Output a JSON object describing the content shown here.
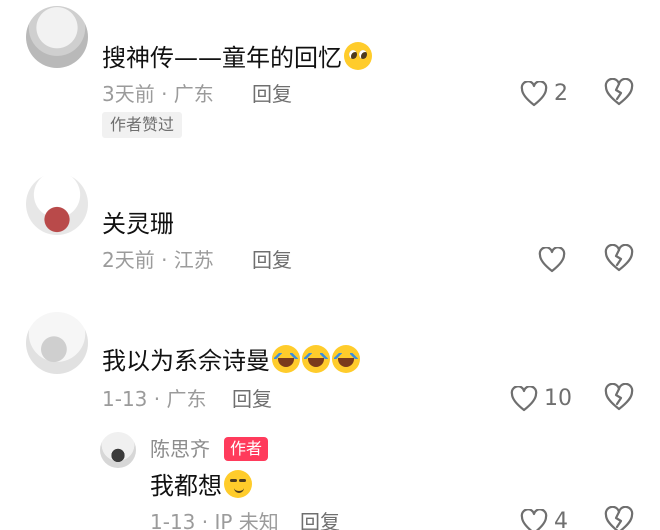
{
  "comments": [
    {
      "text": "搜神传——童年的回忆",
      "emoji": "pleading-face-emoji",
      "meta": "3天前 · 广东",
      "reply_label": "回复",
      "like_count": "2",
      "badge": "作者赞过"
    },
    {
      "text": "关灵珊",
      "meta": "2天前 · 江苏",
      "reply_label": "回复",
      "like_count": ""
    },
    {
      "text": "我以为系佘诗曼",
      "emoji": "rolling-laughing-emoji",
      "meta": "1-13 · 广东",
      "reply_label": "回复",
      "like_count": "10",
      "reply": {
        "author": "陈思齐",
        "author_tag": "作者",
        "text": "我都想",
        "emoji": "smirk-emoji",
        "meta": "1-13 · IP 未知",
        "reply_label": "回复",
        "like_count": "4"
      }
    }
  ],
  "icons": {
    "like": "heart-outline-icon",
    "dislike": "broken-heart-icon"
  },
  "colors": {
    "author_tag_bg": "#ff3b5c",
    "meta_text": "#9b9b9b"
  }
}
